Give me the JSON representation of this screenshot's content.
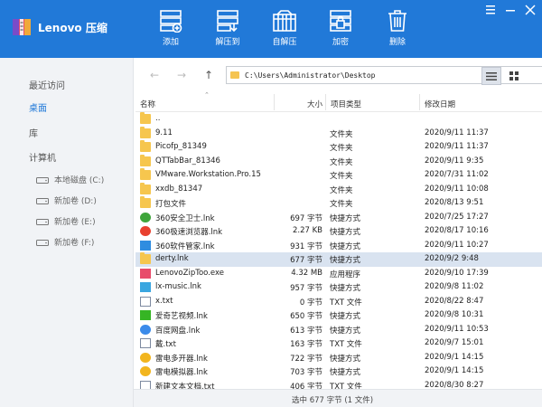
{
  "app": {
    "title": "Lenovo 压缩"
  },
  "toolbar": {
    "add": "添加",
    "extract_to": "解压到",
    "self_extract": "自解压",
    "encrypt": "加密",
    "delete": "删除"
  },
  "sidebar": {
    "recent": "最近访问",
    "desktop": "桌面",
    "library": "库",
    "computer": "计算机",
    "drives": [
      {
        "label": "本地磁盘 (C:)"
      },
      {
        "label": "新加卷 (D:)"
      },
      {
        "label": "新加卷 (E:)"
      },
      {
        "label": "新加卷 (F:)"
      }
    ]
  },
  "address": {
    "path": "C:\\Users\\Administrator\\Desktop"
  },
  "columns": {
    "name": "名称",
    "size": "大小",
    "type": "项目类型",
    "date": "修改日期"
  },
  "files": [
    {
      "name": "..",
      "size": "",
      "type": "",
      "date": "",
      "icon": "folder"
    },
    {
      "name": "9.11",
      "size": "",
      "type": "文件夹",
      "date": "2020/9/11 11:37",
      "icon": "folder"
    },
    {
      "name": "Picofp_81349",
      "size": "",
      "type": "文件夹",
      "date": "2020/9/11 11:37",
      "icon": "folder"
    },
    {
      "name": "QTTabBar_81346",
      "size": "",
      "type": "文件夹",
      "date": "2020/9/11 9:35",
      "icon": "folder"
    },
    {
      "name": "VMware.Workstation.Pro.15",
      "size": "",
      "type": "文件夹",
      "date": "2020/7/31 11:02",
      "icon": "folder"
    },
    {
      "name": "xxdb_81347",
      "size": "",
      "type": "文件夹",
      "date": "2020/9/11 10:08",
      "icon": "folder"
    },
    {
      "name": "打包文件",
      "size": "",
      "type": "文件夹",
      "date": "2020/8/13 9:51",
      "icon": "folder"
    },
    {
      "name": "360安全卫士.lnk",
      "size": "697 字节",
      "type": "快捷方式",
      "date": "2020/7/25 17:27",
      "icon": "360"
    },
    {
      "name": "360极速浏览器.lnk",
      "size": "2.27 KB",
      "type": "快捷方式",
      "date": "2020/8/17 10:16",
      "icon": "browser"
    },
    {
      "name": "360软件管家.lnk",
      "size": "931 字节",
      "type": "快捷方式",
      "date": "2020/9/11 10:27",
      "icon": "softmgr"
    },
    {
      "name": "derty.lnk",
      "size": "677 字节",
      "type": "快捷方式",
      "date": "2020/9/2 9:48",
      "icon": "folder",
      "selected": true
    },
    {
      "name": "LenovoZipToo.exe",
      "size": "4.32 MB",
      "type": "应用程序",
      "date": "2020/9/10 17:39",
      "icon": "lenovo"
    },
    {
      "name": "lx-music.lnk",
      "size": "957 字节",
      "type": "快捷方式",
      "date": "2020/9/8 11:02",
      "icon": "music"
    },
    {
      "name": "x.txt",
      "size": "0 字节",
      "type": "TXT 文件",
      "date": "2020/8/22 8:47",
      "icon": "doc"
    },
    {
      "name": "爱奇艺视频.lnk",
      "size": "650 字节",
      "type": "快捷方式",
      "date": "2020/9/8 10:31",
      "icon": "iqiyi"
    },
    {
      "name": "百度网盘.lnk",
      "size": "613 字节",
      "type": "快捷方式",
      "date": "2020/9/11 10:53",
      "icon": "baidu"
    },
    {
      "name": "戴.txt",
      "size": "163 字节",
      "type": "TXT 文件",
      "date": "2020/9/7 15:01",
      "icon": "doc"
    },
    {
      "name": "雷电多开器.lnk",
      "size": "722 字节",
      "type": "快捷方式",
      "date": "2020/9/1 14:15",
      "icon": "ld"
    },
    {
      "name": "雷电模拟器.lnk",
      "size": "703 字节",
      "type": "快捷方式",
      "date": "2020/9/1 14:15",
      "icon": "ld"
    },
    {
      "name": "新建文本文档.txt",
      "size": "406 字节",
      "type": "TXT 文件",
      "date": "2020/8/30 8:27",
      "icon": "doc"
    }
  ],
  "status": {
    "text": "选中  677 字节 (1 文件)"
  },
  "colors": {
    "brand": "#2179d8",
    "selected_row": "#d9e3f0",
    "folder": "#f6c64e"
  }
}
